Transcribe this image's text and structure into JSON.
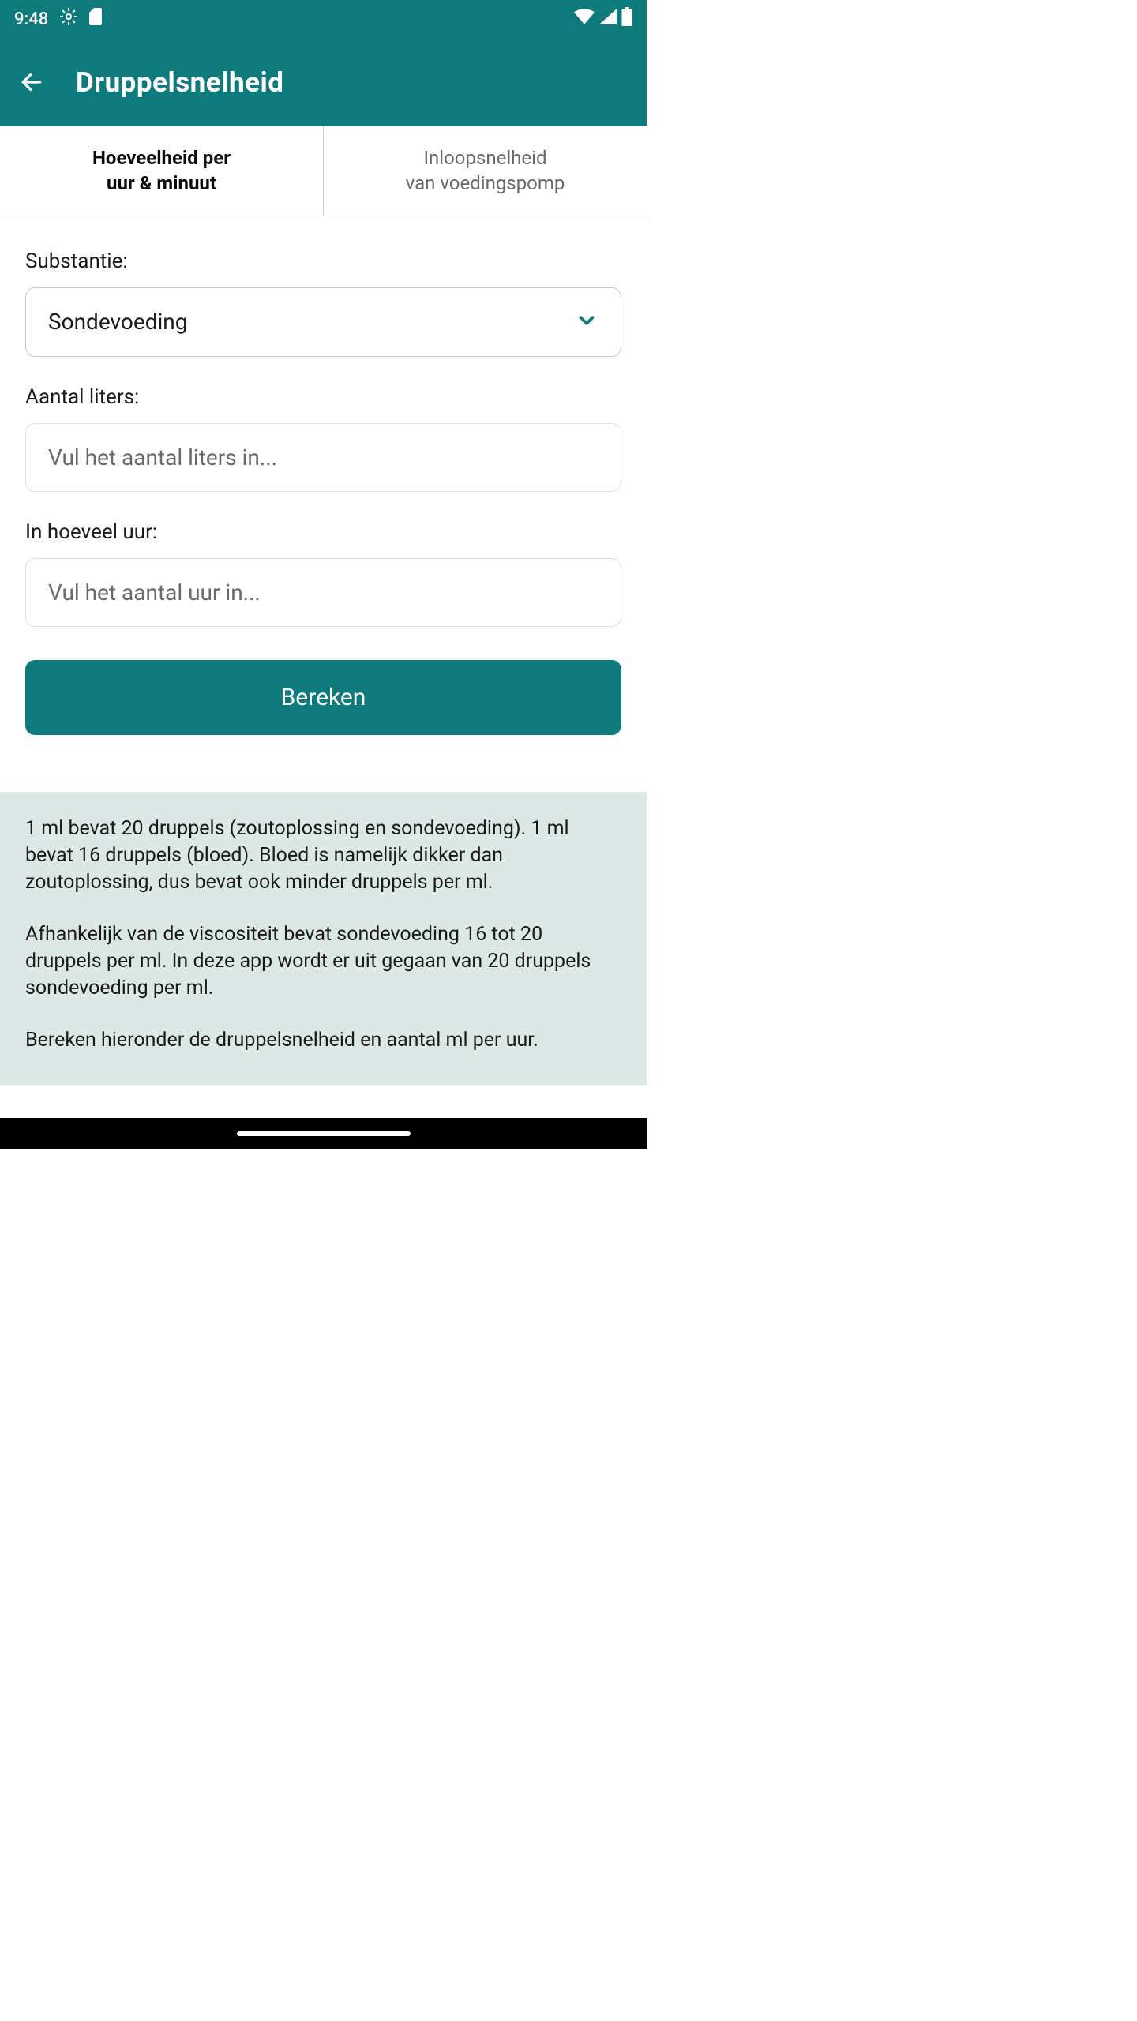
{
  "status_bar": {
    "time": "9:48"
  },
  "app_bar": {
    "title": "Druppelsnelheid"
  },
  "tabs": {
    "active": "Hoeveelheid per\nuur & minuut",
    "inactive": "Inloopsnelheid\nvan voedingspomp"
  },
  "form": {
    "substance_label": "Substantie:",
    "substance_value": "Sondevoeding",
    "liters_label": "Aantal liters:",
    "liters_placeholder": "Vul het aantal liters in...",
    "hours_label": "In hoeveel uur:",
    "hours_placeholder": "Vul het aantal uur in...",
    "calculate_label": "Bereken"
  },
  "info": {
    "paragraph1": "1 ml bevat 20 druppels (zoutoplossing en sondevoeding). 1 ml bevat 16 druppels (bloed). Bloed is namelijk dikker dan zoutoplossing, dus bevat ook minder druppels per ml.",
    "paragraph2": "Afhankelijk van de viscositeit bevat sondevoeding 16 tot 20 druppels per ml. In deze app wordt er uit gegaan van 20 druppels sondevoeding per ml.",
    "paragraph3": "Bereken hieronder de druppelsnelheid en aantal ml per uur."
  }
}
